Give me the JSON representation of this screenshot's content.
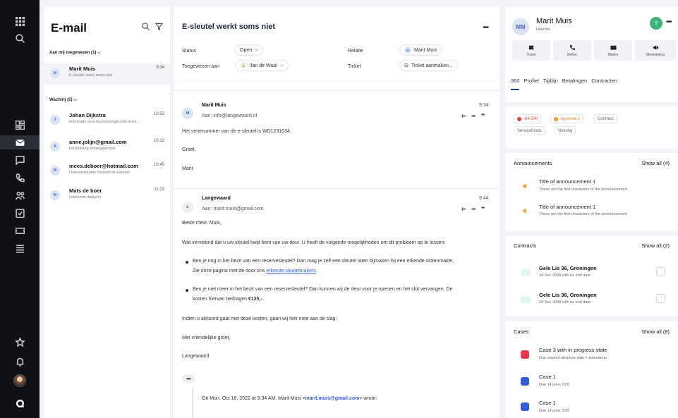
{
  "inbox": {
    "title": "E-mail",
    "assigned_header": "Aan mij toegewezen (1)",
    "waiting_header": "Wachtrij (5)",
    "assigned_items": [
      {
        "initial": "M",
        "name": "Marit Muis",
        "snippet": "E-sleutel werkt soms niet",
        "time": "9:34"
      }
    ],
    "waiting_items": [
      {
        "initial": "J",
        "name": "Johan Dijkstra",
        "snippet": "Informatie over huurwoningen die te ko ...",
        "time": "10:52"
      },
      {
        "initial": "A",
        "name": "anne.jolijn@gmail.com",
        "snippet": "Inschrijving woningaanbod",
        "time": "10:12"
      },
      {
        "initial": "M",
        "name": "mees.deboer@hotmail.com",
        "snippet": "Overlastsituatie rondom de Fennen",
        "time": "10:45"
      },
      {
        "initial": "M",
        "name": "Mats de boer",
        "snippet": "Lekkende dakgoot",
        "time": "11:13"
      }
    ]
  },
  "mail": {
    "title": "E-sleutel werkt soms niet",
    "status_label": "Status",
    "status_value": "Open",
    "relation_label": "Relatie",
    "relation_initial": "M",
    "relation_value": "Marit Muis",
    "assigned_label": "Toegewezen aan",
    "assigned_initial": "J",
    "assigned_value": "Jan de Waal",
    "ticket_label": "Ticket",
    "ticket_value": "Ticket aanmaken...",
    "msg1": {
      "initial": "M",
      "sender": "Marit Muis",
      "to": "Aan: info@langewaard.nl",
      "time": "9:34",
      "line1": "Het serienummer van de e-sleutel is WD1231034.",
      "line2": "Groet,",
      "line3": "Marit"
    },
    "msg2": {
      "initial": "L",
      "sender": "Langewaard",
      "to": "Aan: marit.muis@gmail.com",
      "time": "9:44",
      "greeting": "Beste mevr. Muis,",
      "intro": "Wat vervelend dat u uw sleutel kwijt bent van uw deur. U heeft de volgende mogelijkheden om dit probleem op te lossen:",
      "b1_line1": "Ben je nog in het bezit van een reservesleutel? Dan mag je zelf een sleutel laten bijmaken bij een erkende slotenmaker.",
      "b1_line2_pre": "Zie onze pagina met de door ons ",
      "b1_link": "erkende sleutelmakers",
      "b1_line2_post": ".",
      "b2_line1": "Ben je niet meer in het bezit van een reservesleutel? Dan kunnen wij de deur voor je openen en het slot vervangen. De",
      "b2_line2_pre": "kosten hiervan bedragen ",
      "b2_amount": "€125,-",
      "b2_line2_post": ".",
      "p3": "Indien u akkoord gaat met deze kosten, gaan wij hier mee aan de slag.",
      "closing": "Met vriendelijke groet,",
      "signature": "Langewaard",
      "quote_pre": "On Mon, Oct 18, 2022 at 9:34 AM, Marit Muis <",
      "quote_email": "marit.muis@gmail.com",
      "quote_post": "> wrote:"
    }
  },
  "profile": {
    "initials": "MM",
    "name": "Marit Muis",
    "role": "Huurder",
    "help": "?",
    "actions": [
      "Ticket",
      "Bellen",
      "Mailen",
      "Mededeling"
    ],
    "tabs": [
      "360",
      "Profiel",
      "Tijdlijn",
      "Betalingen",
      "Contracten"
    ]
  },
  "tags": {
    "debt": "-€4.500",
    "aggression": "Agressie 1",
    "contract": "Contract",
    "service": "Servicefonds",
    "housing": "Woning"
  },
  "announcements": {
    "title": "Announcements",
    "show_all": "Show all (4)",
    "items": [
      {
        "title": "Title of announcement 1",
        "text": "These are the first characters of the announcement"
      },
      {
        "title": "Title of announcement 1",
        "text": "These are the first characters of the announcement"
      }
    ]
  },
  "contracts": {
    "title": "Contracts",
    "show_all": "Show all (2)",
    "items": [
      {
        "title": "Gele Lis 36, Groningen",
        "text": "24 Dec 2008 with no end date"
      },
      {
        "title": "Gele Lis 36, Groningen",
        "text": "24 Dec 2008 with no end date"
      }
    ]
  },
  "cases": {
    "title": "Cases",
    "show_all": "Show all (8)",
    "items": [
      {
        "title": "Case 3 with in progress state",
        "text": "Due expired absolute date + timestamp",
        "color": "#e23b4e"
      },
      {
        "title": "Case 1",
        "text": "Due 14 june, 9:00",
        "color": "#2f5fd0"
      },
      {
        "title": "Case 1",
        "text": "Due 14 june, 9:00",
        "color": "#2f5fd0"
      }
    ]
  },
  "colors": {
    "accent": "#1e3a8a",
    "help": "#3fb47a",
    "rail": "#0f1115"
  }
}
